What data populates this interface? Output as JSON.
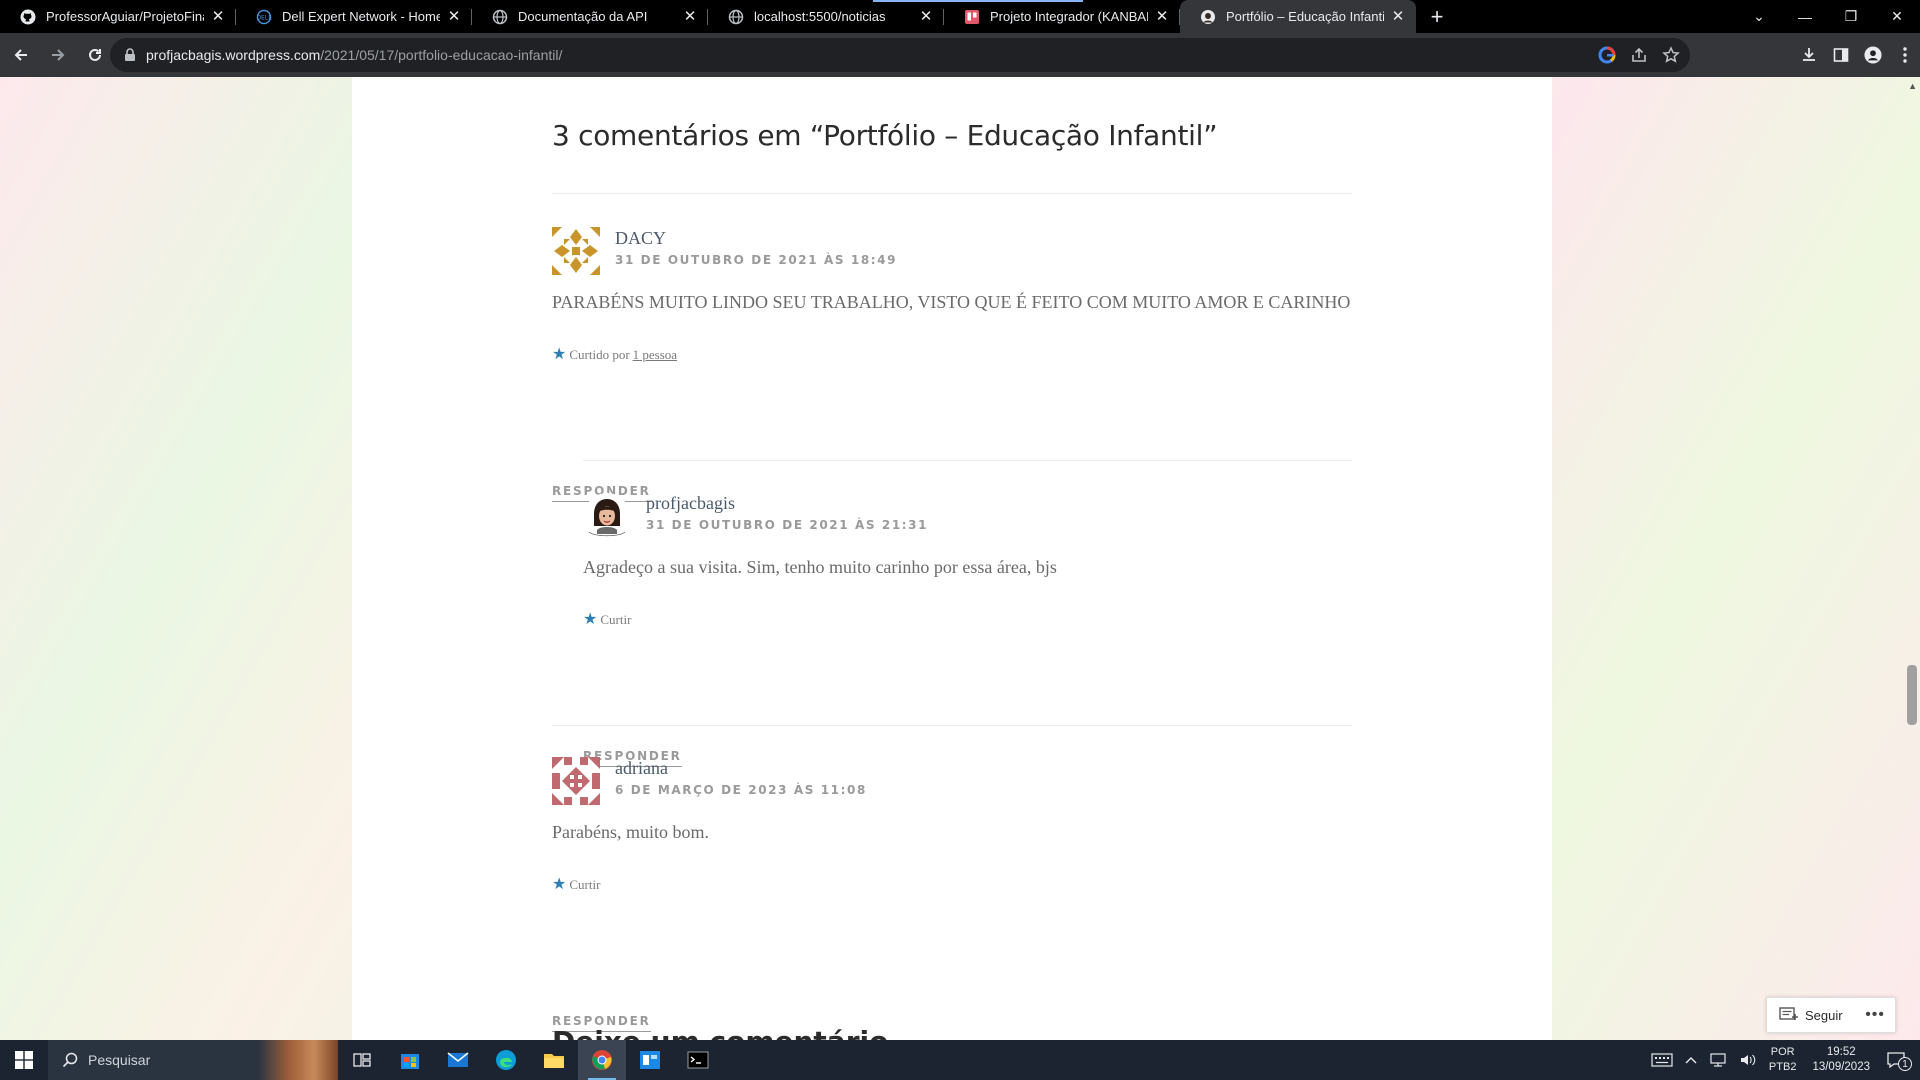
{
  "browser": {
    "tabs": [
      {
        "title": "ProfessorAguiar/ProjetoFinal-NI",
        "icon": "github-icon",
        "active": false
      },
      {
        "title": "Dell Expert Network - Home",
        "icon": "dell-icon",
        "active": false
      },
      {
        "title": "Documentação da API",
        "icon": "globe-icon",
        "active": false
      },
      {
        "title": "localhost:5500/noticias",
        "icon": "globe-icon",
        "active": false
      },
      {
        "title": "Projeto Integrador (KANBAN) | Tr",
        "icon": "trello-icon",
        "active": false
      },
      {
        "title": "Portfólio – Educação Infantil – Pr",
        "icon": "wordpress-icon",
        "active": true
      }
    ],
    "url_host": "profjacbagis.wordpress.com",
    "url_path": "/2021/05/17/portfolio-educacao-infantil/"
  },
  "comments": {
    "title": "3 comentários em “Portfólio – Educação Infantil”",
    "items": [
      {
        "author": "DACY",
        "date": "31 DE OUTUBRO DE 2021 ÀS 18:49",
        "text": "PARABÉNS MUITO LINDO SEU TRABALHO, VISTO QUE É FEITO COM MUITO AMOR E CARINHO",
        "like_prefix": "Curtido por",
        "like_link": "1 pessoa",
        "reply": "RESPONDER"
      },
      {
        "author": "profjacbagis",
        "date": "31 DE OUTUBRO DE 2021 ÀS 21:31",
        "text": "Agradeço a sua visita. Sim, tenho muito carinho por essa área, bjs",
        "like": "Curtir",
        "reply": "RESPONDER"
      },
      {
        "author": "adriana",
        "date": "6 DE MARÇO DE 2023 ÀS 11:08",
        "text": "Parabéns, muito bom.",
        "like": "Curtir",
        "reply": "RESPONDER"
      }
    ],
    "leave_title": "Deixe um comentário"
  },
  "follow_button": {
    "label": "Seguir"
  },
  "taskbar": {
    "search_placeholder": "Pesquisar",
    "lang_top": "POR",
    "lang_bottom": "PTB2",
    "time": "19:52",
    "date": "13/09/2023",
    "notifications": "1"
  },
  "colors": {
    "accent_star": "#2f7fb7",
    "dacy_avatar": "#c9952a",
    "adriana_avatar": "#c06a70"
  }
}
